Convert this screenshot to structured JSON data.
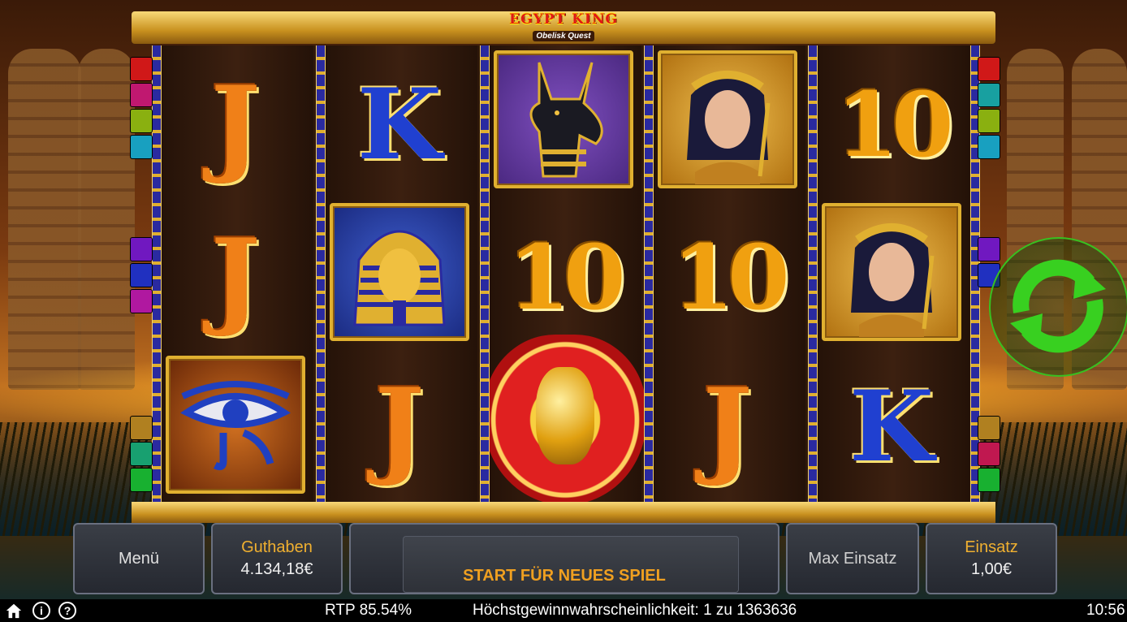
{
  "logo": {
    "title": "EGYPT KING",
    "subtitle": "Obelisk Quest"
  },
  "reels": [
    [
      {
        "symbol": "J"
      },
      {
        "symbol": "J"
      },
      {
        "symbol": "eye-of-horus"
      }
    ],
    [
      {
        "symbol": "K"
      },
      {
        "symbol": "pharaoh"
      },
      {
        "symbol": "J"
      }
    ],
    [
      {
        "symbol": "anubis"
      },
      {
        "symbol": "10"
      },
      {
        "symbol": "scarab"
      }
    ],
    [
      {
        "symbol": "queen"
      },
      {
        "symbol": "10"
      },
      {
        "symbol": "J"
      }
    ],
    [
      {
        "symbol": "10"
      },
      {
        "symbol": "queen"
      },
      {
        "symbol": "K"
      }
    ]
  ],
  "symbols": {
    "J": "J",
    "K": "K",
    "10": "10"
  },
  "controls": {
    "menu_label": "Menü",
    "balance_label": "Guthaben",
    "balance_value": "4.134,18€",
    "start_label": "START FÜR NEUES SPIEL",
    "max_bet_label": "Max Einsatz",
    "bet_label": "Einsatz",
    "bet_value": "1,00€"
  },
  "status_bar": {
    "rtp": "RTP 85.54%",
    "max_win_probability": "Höchstgewinnwahrscheinlichkeit: 1 zu 1363636",
    "time": "10:56"
  },
  "icons": {
    "home": "home-icon",
    "info": "info-icon",
    "help": "help-icon",
    "spin": "spin-icon"
  },
  "colors": {
    "accent_gold": "#f0b030",
    "spin_green": "#38c020",
    "frame_gold": "#e0b030"
  }
}
